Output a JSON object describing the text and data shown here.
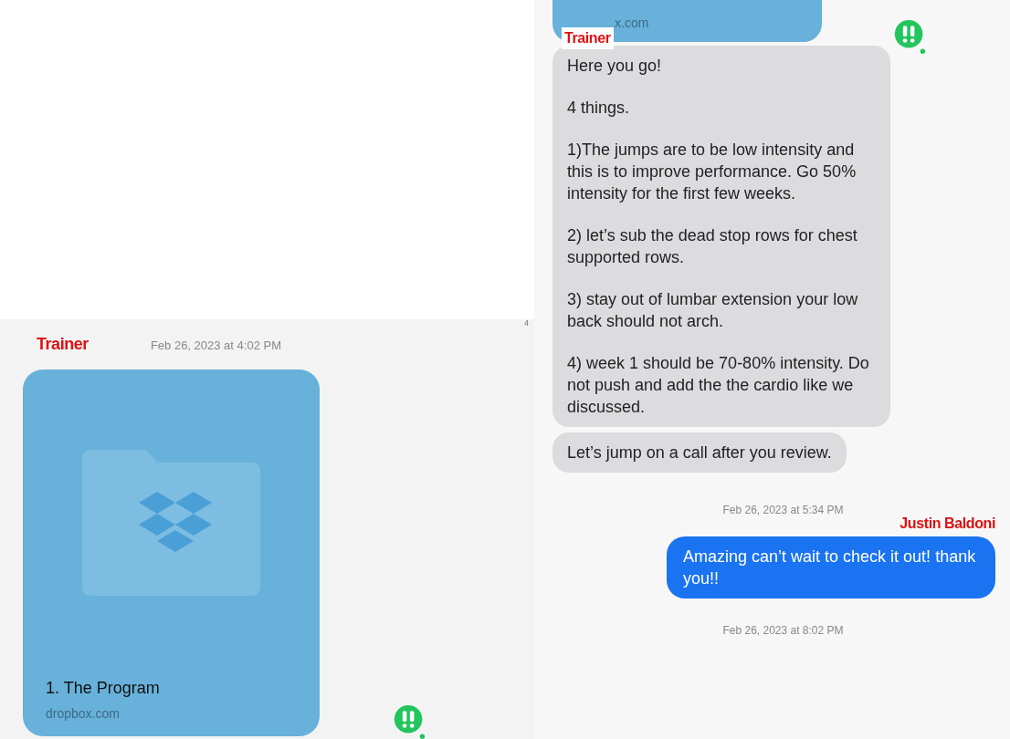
{
  "left_panel": {
    "sender_label": "Trainer",
    "timestamp": "Feb 26, 2023 at 4:02 PM",
    "link_card": {
      "title": "1. The Program",
      "domain": "dropbox.com"
    },
    "page_mark": "4"
  },
  "right_panel": {
    "top_card": {
      "domain": "x.com"
    },
    "sender_label": "Trainer",
    "items": [
      {
        "kind": "incoming",
        "paragraphs": [
          "Here you go!",
          "4 things.",
          "1)The jumps are to be low intensity and this is to improve performance. Go 50% intensity for the first few weeks.",
          "2) let’s sub the dead stop rows for chest supported rows.",
          "3) stay out of lumbar extension your low back should not arch.",
          "4) week 1 should be 70-80% intensity. Do not push and add the the cardio like we discussed."
        ]
      },
      {
        "kind": "incoming",
        "paragraphs": [
          "Let’s jump on a call after you review."
        ]
      },
      {
        "kind": "timestamp",
        "text": "Feb 26, 2023 at 5:34 PM"
      },
      {
        "kind": "sender_label",
        "text": "Justin Baldoni"
      },
      {
        "kind": "outgoing",
        "paragraphs": [
          "Amazing can’t wait to check it out! thank you!!"
        ]
      },
      {
        "kind": "timestamp",
        "text": "Feb 26, 2023 at 8:02 PM"
      }
    ]
  }
}
